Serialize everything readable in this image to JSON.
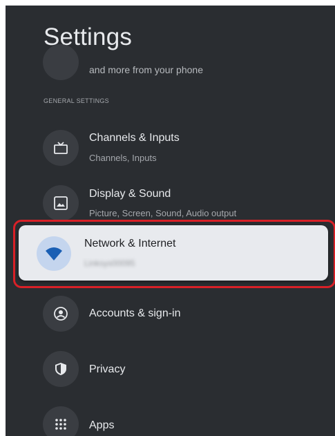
{
  "page": {
    "title": "Settings"
  },
  "partial_item": {
    "text": "and more from your phone"
  },
  "section": {
    "header": "GENERAL SETTINGS"
  },
  "items": [
    {
      "label": "Channels & Inputs",
      "subtitle": "Channels, Inputs",
      "icon": "tv-icon"
    },
    {
      "label": "Display & Sound",
      "subtitle": "Picture, Screen, Sound, Audio output",
      "icon": "image-icon"
    },
    {
      "label": "Network & Internet",
      "subtitle": "Linksys00095",
      "icon": "wifi-icon",
      "focused": true
    },
    {
      "label": "Accounts & sign-in",
      "icon": "account-icon"
    },
    {
      "label": "Privacy",
      "icon": "shield-icon"
    },
    {
      "label": "Apps",
      "icon": "apps-grid-icon"
    }
  ],
  "colors": {
    "focus_outline": "#d92027",
    "focus_card": "#e8eaee",
    "background": "#2a2d31",
    "wifi_blue": "#1a5fb4"
  }
}
